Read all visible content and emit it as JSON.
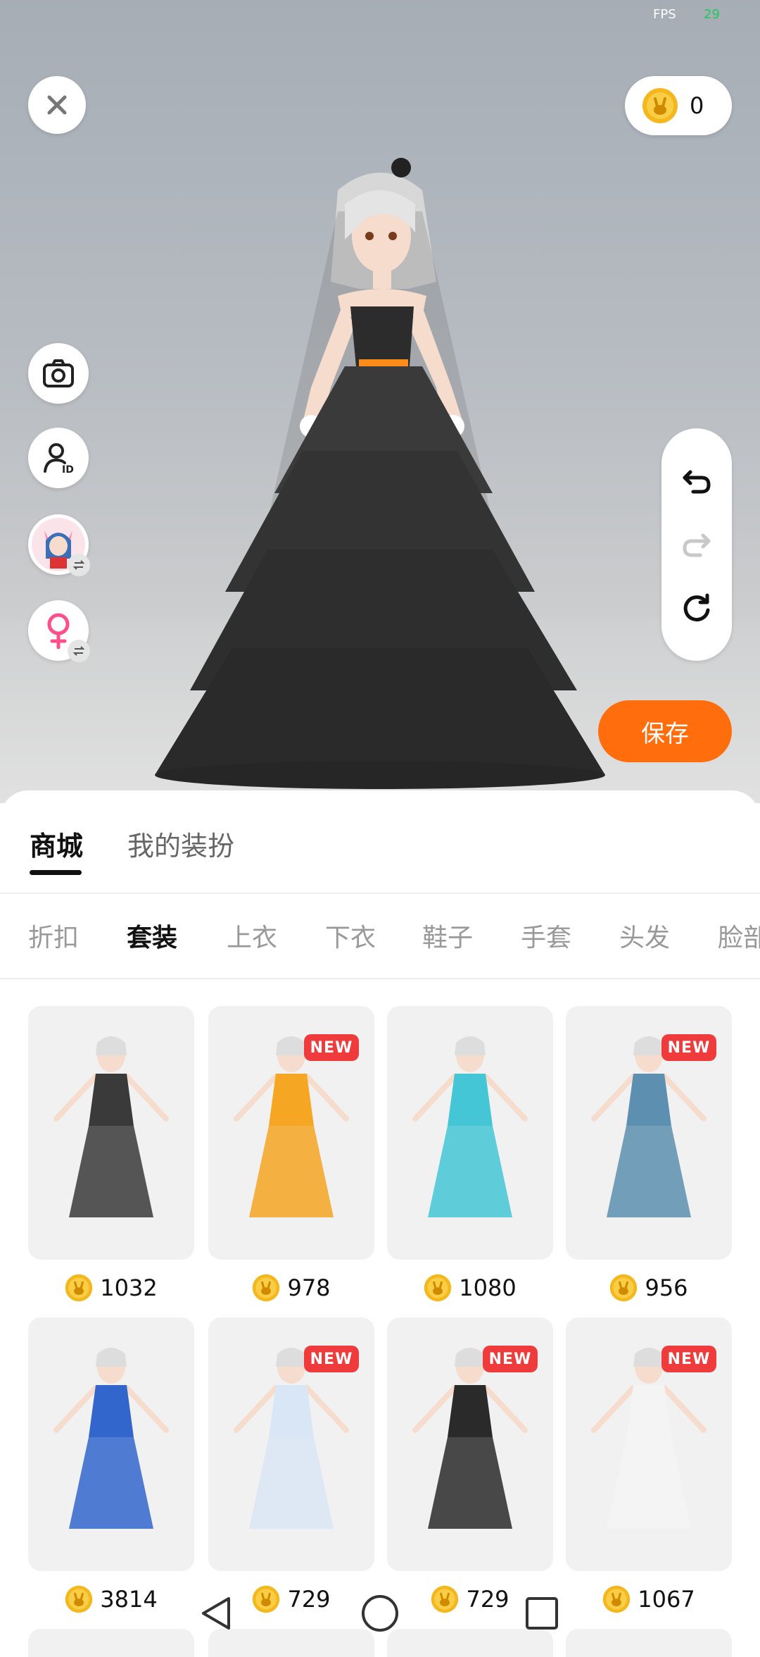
{
  "status": {
    "fps_label": "FPS",
    "fps_value": "29"
  },
  "top": {
    "coins": "0",
    "save_label": "保存"
  },
  "main_tabs": {
    "shop": "商城",
    "my_outfits": "我的装扮"
  },
  "categories": [
    "折扣",
    "套装",
    "上衣",
    "下衣",
    "鞋子",
    "手套",
    "头发",
    "脸部"
  ],
  "items": [
    {
      "price": "1032",
      "is_new": false,
      "new_label": "",
      "dress_color": "#3a3a3a"
    },
    {
      "price": "978",
      "is_new": true,
      "new_label": "NEW",
      "dress_color": "#f5a623"
    },
    {
      "price": "1080",
      "is_new": false,
      "new_label": "",
      "dress_color": "#45c6d6"
    },
    {
      "price": "956",
      "is_new": true,
      "new_label": "NEW",
      "dress_color": "#5d8fb0"
    },
    {
      "price": "3814",
      "is_new": false,
      "new_label": "",
      "dress_color": "#3366cc"
    },
    {
      "price": "729",
      "is_new": true,
      "new_label": "NEW",
      "dress_color": "#d9e6f5"
    },
    {
      "price": "729",
      "is_new": true,
      "new_label": "NEW",
      "dress_color": "#2a2a2a"
    },
    {
      "price": "1067",
      "is_new": true,
      "new_label": "NEW",
      "dress_color": "#f4f4f4"
    }
  ],
  "colors": {
    "accent": "#ff6d0c",
    "new_badge": "#ef3b3b",
    "coin": "#f4b81d"
  }
}
